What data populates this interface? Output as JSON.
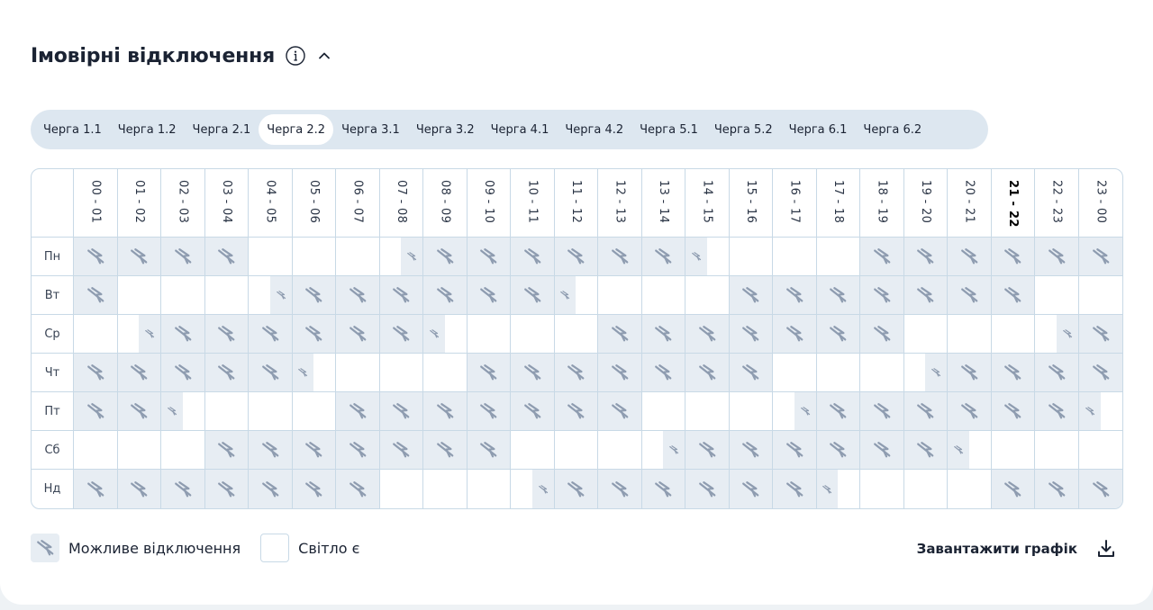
{
  "header": {
    "title": "Імовірні відключення"
  },
  "tabs": [
    "Черга 1.1",
    "Черга 1.2",
    "Черга 2.1",
    "Черга 2.2",
    "Черга 3.1",
    "Черга 3.2",
    "Черга 4.1",
    "Черга 4.2",
    "Черга 5.1",
    "Черга 5.2",
    "Черга 6.1",
    "Черга 6.2"
  ],
  "active_tab_index": 3,
  "schedule": {
    "hours": [
      "00 - 01",
      "01 - 02",
      "02 - 03",
      "03 - 04",
      "04 - 05",
      "05 - 06",
      "06 - 07",
      "07 - 08",
      "08 - 09",
      "09 - 10",
      "10 - 11",
      "11 - 12",
      "12 - 13",
      "13 - 14",
      "14 - 15",
      "15 - 16",
      "16 - 17",
      "17 - 18",
      "18 - 19",
      "19 - 20",
      "20 - 21",
      "21 - 22",
      "22 - 23",
      "23 - 00"
    ],
    "current_hour_index": 21,
    "days": [
      "Пн",
      "Вт",
      "Ср",
      "Чт",
      "Пт",
      "Сб",
      "Нд"
    ],
    "legend_codes": {
      "Y": "possible outage (full hour)",
      "F": "possible outage (first half of hour)",
      "S": "possible outage (second half of hour)",
      "N": "power on"
    },
    "rows": [
      [
        "Y",
        "Y",
        "Y",
        "Y",
        "N",
        "N",
        "N",
        "S",
        "Y",
        "Y",
        "Y",
        "Y",
        "Y",
        "Y",
        "F",
        "N",
        "N",
        "N",
        "Y",
        "Y",
        "Y",
        "Y",
        "Y",
        "Y"
      ],
      [
        "Y",
        "N",
        "N",
        "N",
        "S",
        "Y",
        "Y",
        "Y",
        "Y",
        "Y",
        "Y",
        "F",
        "N",
        "N",
        "N",
        "Y",
        "Y",
        "Y",
        "Y",
        "Y",
        "Y",
        "Y",
        "N",
        "N"
      ],
      [
        "N",
        "S",
        "Y",
        "Y",
        "Y",
        "Y",
        "Y",
        "Y",
        "F",
        "N",
        "N",
        "N",
        "Y",
        "Y",
        "Y",
        "Y",
        "Y",
        "Y",
        "Y",
        "N",
        "N",
        "N",
        "S",
        "Y"
      ],
      [
        "Y",
        "Y",
        "Y",
        "Y",
        "Y",
        "F",
        "N",
        "N",
        "N",
        "Y",
        "Y",
        "Y",
        "Y",
        "Y",
        "Y",
        "Y",
        "N",
        "N",
        "N",
        "S",
        "Y",
        "Y",
        "Y",
        "Y"
      ],
      [
        "Y",
        "Y",
        "F",
        "N",
        "N",
        "N",
        "Y",
        "Y",
        "Y",
        "Y",
        "Y",
        "Y",
        "Y",
        "N",
        "N",
        "N",
        "S",
        "Y",
        "Y",
        "Y",
        "Y",
        "Y",
        "Y",
        "F"
      ],
      [
        "N",
        "N",
        "N",
        "Y",
        "Y",
        "Y",
        "Y",
        "Y",
        "Y",
        "Y",
        "N",
        "N",
        "N",
        "S",
        "Y",
        "Y",
        "Y",
        "Y",
        "Y",
        "Y",
        "F",
        "N",
        "N",
        "N"
      ],
      [
        "Y",
        "Y",
        "Y",
        "Y",
        "Y",
        "Y",
        "Y",
        "N",
        "N",
        "N",
        "S",
        "Y",
        "Y",
        "Y",
        "Y",
        "Y",
        "Y",
        "F",
        "N",
        "N",
        "N",
        "Y",
        "Y",
        "Y"
      ]
    ]
  },
  "legend": {
    "outage_label": "Можливе відключення",
    "light_label": "Світло є"
  },
  "download": {
    "label": "Завантажити графік"
  },
  "icons": {
    "info": "info-icon",
    "chevron": "chevron-up-icon",
    "outage": "lightning-off-icon",
    "download": "download-icon"
  },
  "colors": {
    "outage_fill": "#e7edf3",
    "icon": "#8e9cb0",
    "border": "#c8d9e6",
    "tabs_bg": "#dde7f0"
  }
}
